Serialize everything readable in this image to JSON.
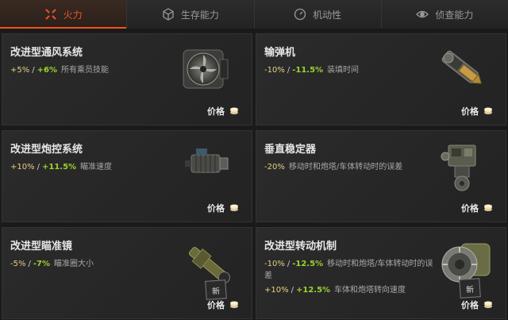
{
  "tabs": [
    {
      "label": "火力",
      "icon": "crosshair-icon",
      "active": true
    },
    {
      "label": "生存能力",
      "icon": "armor-cube-icon",
      "active": false
    },
    {
      "label": "机动性",
      "icon": "speedometer-icon",
      "active": false
    },
    {
      "label": "侦查能力",
      "icon": "eye-icon",
      "active": false
    }
  ],
  "cards": [
    {
      "name": "改进型通风系统",
      "stats": [
        {
          "base": "+5%",
          "sep": "/",
          "bonus": "+6%",
          "desc": "所有乘员技能"
        }
      ],
      "price_label": "价格",
      "new_badge": ""
    },
    {
      "name": "输弹机",
      "stats": [
        {
          "base": "-10%",
          "sep": "/",
          "bonus": "-11.5%",
          "desc": "装填时间"
        }
      ],
      "price_label": "价格",
      "new_badge": ""
    },
    {
      "name": "改进型炮控系统",
      "stats": [
        {
          "base": "+10%",
          "sep": "/",
          "bonus": "+11.5%",
          "desc": "瞄准速度"
        }
      ],
      "price_label": "价格",
      "new_badge": ""
    },
    {
      "name": "垂直稳定器",
      "stats": [
        {
          "base": "-20%",
          "sep": "",
          "bonus": "",
          "desc": "移动时和炮塔/车体转动时的误差"
        }
      ],
      "price_label": "价格",
      "new_badge": ""
    },
    {
      "name": "改进型瞄准镜",
      "stats": [
        {
          "base": "-5%",
          "sep": "/",
          "bonus": "-7%",
          "desc": "瞄准圈大小"
        }
      ],
      "price_label": "价格",
      "new_badge": "新"
    },
    {
      "name": "改进型转动机制",
      "stats": [
        {
          "base": "-10%",
          "sep": "/",
          "bonus": "-12.5%",
          "desc": "移动时和炮塔/车体转动时的误差"
        },
        {
          "base": "+10%",
          "sep": "/",
          "bonus": "+12.5%",
          "desc": "车体和炮塔转向速度"
        }
      ],
      "price_label": "价格",
      "new_badge": "新"
    }
  ],
  "colors": {
    "accent": "#f25322",
    "bonus": "#9cd230",
    "base": "#e8d080"
  }
}
